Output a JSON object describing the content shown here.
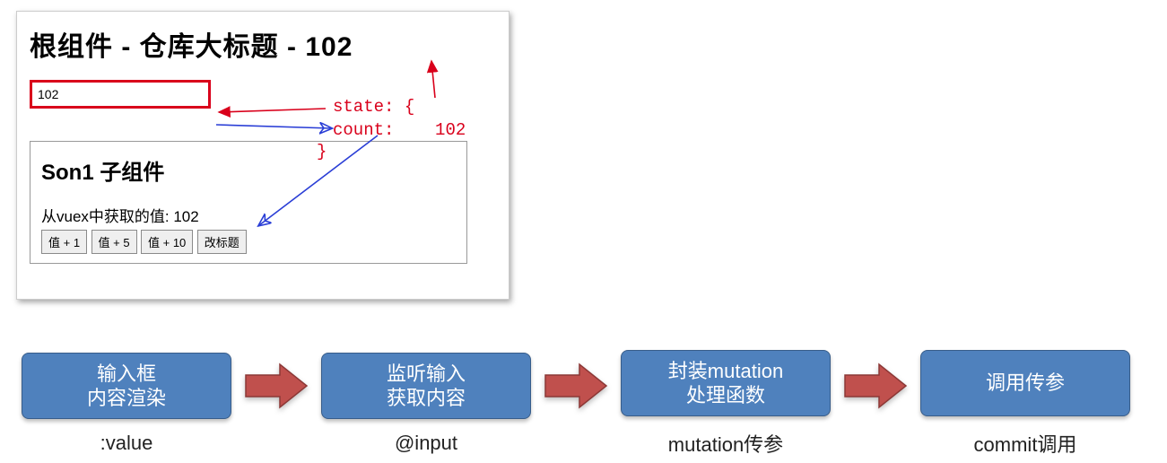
{
  "card": {
    "title": "根组件 - 仓库大标题 - 102",
    "inputValue": "102",
    "stateLine": "state:  {",
    "countLabel": "count:",
    "countValue": "102",
    "braceClose": "}",
    "son": {
      "title": "Son1 子组件",
      "text": "从vuex中获取的值: 102",
      "btn1": "值 + 1",
      "btn2": "值 + 5",
      "btn3": "值 + 10",
      "btn4": "改标题"
    }
  },
  "flow": {
    "step1": {
      "label": "输入框\n内容渲染",
      "caption": ":value"
    },
    "step2": {
      "label": "监听输入\n获取内容",
      "caption": "@input"
    },
    "step3": {
      "label": "封装mutation\n处理函数",
      "caption": "mutation传参"
    },
    "step4": {
      "label": "调用传参",
      "caption": "commit调用"
    }
  }
}
